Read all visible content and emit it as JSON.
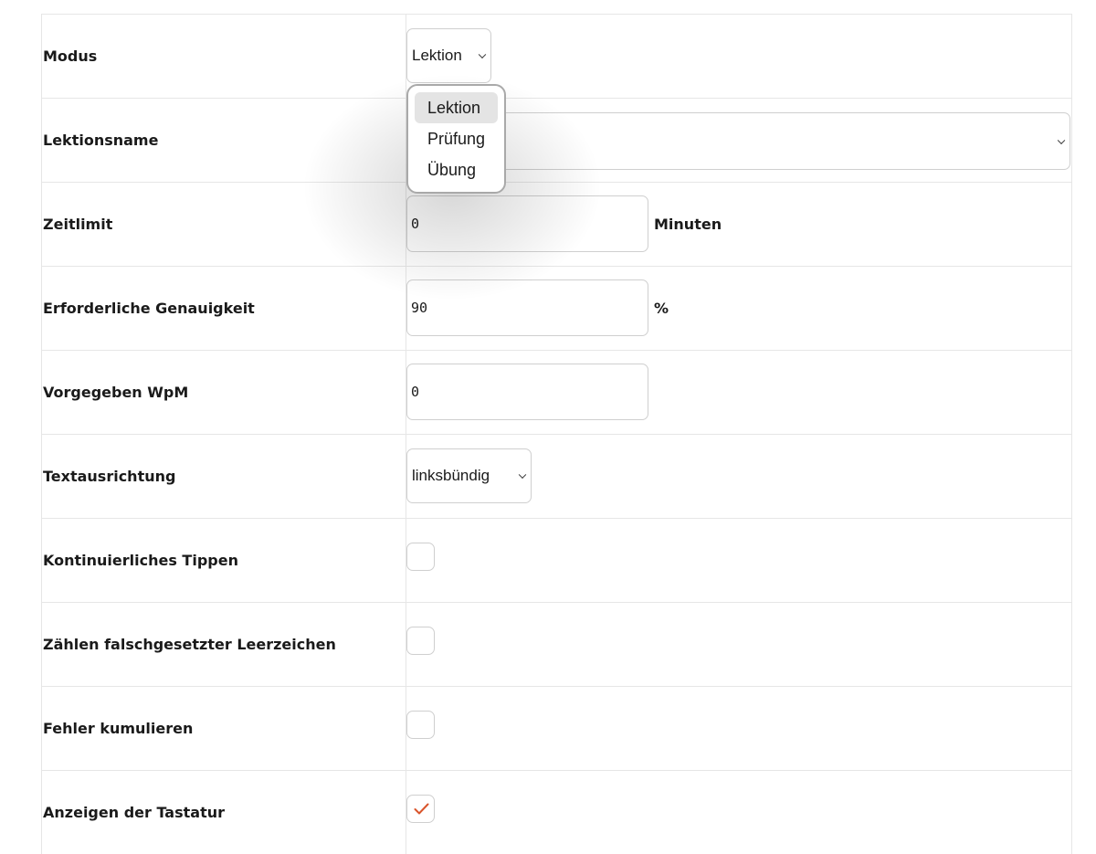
{
  "rows": {
    "mode": {
      "label": "Modus",
      "value": "Lektion"
    },
    "lesson_name": {
      "label": "Lektionsname",
      "value": ""
    },
    "time_limit": {
      "label": "Zeitlimit",
      "value": "0",
      "unit": "Minuten"
    },
    "accuracy": {
      "label": "Erforderliche Genauigkeit",
      "value": "90",
      "unit": "%"
    },
    "wpm": {
      "label": "Vorgegeben WpM",
      "value": "0"
    },
    "alignment": {
      "label": "Textausrichtung",
      "value": "linksbündig"
    },
    "continuous_typing": {
      "label": "Kontinuierliches Tippen",
      "checked": false
    },
    "count_spaces": {
      "label": "Zählen falschgesetzter Leerzeichen",
      "checked": false
    },
    "accumulate_errors": {
      "label": "Fehler kumulieren",
      "checked": false
    },
    "show_keyboard": {
      "label": "Anzeigen der Tastatur",
      "checked": true
    }
  },
  "mode_dropdown": {
    "options": [
      "Lektion",
      "Prüfung",
      "Übung"
    ],
    "selected": "Lektion"
  },
  "colors": {
    "checkmark": "#d9542b",
    "border": "#e6e6e6",
    "selected_option_bg": "#e4e4e4"
  },
  "icons": {
    "select_arrow": "chevron-down-icon",
    "check": "checkmark-icon"
  }
}
